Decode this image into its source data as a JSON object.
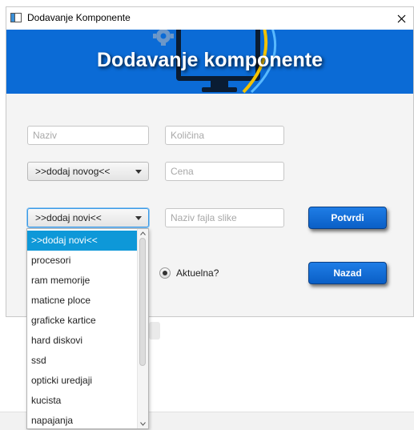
{
  "window": {
    "title": "Dodavanje Komponente",
    "close_glyph": "✕"
  },
  "banner": {
    "title": "Dodavanje komponente"
  },
  "form": {
    "naziv_placeholder": "Naziv",
    "kolicina_placeholder": "Količina",
    "cena_placeholder": "Cena",
    "slika_placeholder": "Naziv fajla slike",
    "proizvodjac_value": ">>dodaj novog<<",
    "kategorija_value": ">>dodaj novi<<",
    "aktuelna_label": "Aktuelna?",
    "potvrdi_label": "Potvrdi",
    "nazad_label": "Nazad"
  },
  "dropdown": {
    "selected_index": 0,
    "items": [
      ">>dodaj novi<<",
      "procesori",
      "ram memorije",
      "maticne ploce",
      "graficke kartice",
      "hard diskovi",
      "ssd",
      "opticki uredjaji",
      "kucista",
      "napajanja"
    ]
  },
  "colors": {
    "accent": "#0b6bd6",
    "selection": "#0e98d8"
  },
  "icons": {
    "app": "window-icon",
    "close": "close-icon",
    "combo": "chevron-down-icon"
  }
}
